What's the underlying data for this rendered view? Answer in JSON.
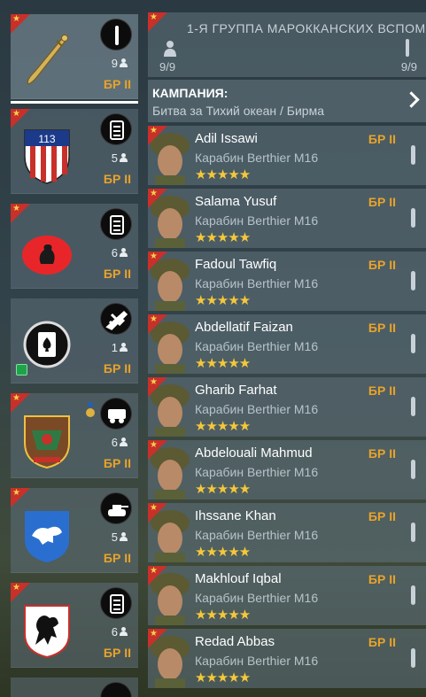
{
  "squads": [
    {
      "count": "9",
      "br": "БР II",
      "type_icon": "rifle-icon",
      "emblem": "dagger-emblem",
      "selected": true
    },
    {
      "count": "5",
      "br": "БР II",
      "type_icon": "clipboard-icon",
      "emblem": "shield-113-emblem"
    },
    {
      "count": "6",
      "br": "БР II",
      "type_icon": "clipboard-icon",
      "emblem": "red-creature-emblem"
    },
    {
      "count": "1",
      "br": "БР II",
      "type_icon": "plane-icon",
      "emblem": "ace-spades-emblem",
      "premium": true
    },
    {
      "count": "6",
      "br": "БР II",
      "type_icon": "vehicle-icon",
      "emblem": "regiment-shield-emblem",
      "medal": true
    },
    {
      "count": "5",
      "br": "БР II",
      "type_icon": "tank-icon",
      "emblem": "lion-shield-emblem"
    },
    {
      "count": "6",
      "br": "БР II",
      "type_icon": "clipboard-icon",
      "emblem": "black-lion-emblem"
    }
  ],
  "header": {
    "title": "1-Я ГРУППА МАРОККАНСКИХ ВСПОМ",
    "left_count": "9/9",
    "right_count": "9/9"
  },
  "campaign": {
    "label": "КАМПАНИЯ:",
    "value": "Битва за Тихий океан / Бирма"
  },
  "soldiers": [
    {
      "name": "Adil Issawi",
      "weapon": "Карабин Berthier M16",
      "br": "БР II",
      "stars": "★★★★★"
    },
    {
      "name": "Salama Yusuf",
      "weapon": "Карабин Berthier M16",
      "br": "БР II",
      "stars": "★★★★★"
    },
    {
      "name": "Fadoul Tawfiq",
      "weapon": "Карабин Berthier M16",
      "br": "БР II",
      "stars": "★★★★★"
    },
    {
      "name": "Abdellatif Faizan",
      "weapon": "Карабин Berthier M16",
      "br": "БР II",
      "stars": "★★★★★"
    },
    {
      "name": "Gharib Farhat",
      "weapon": "Карабин Berthier M16",
      "br": "БР II",
      "stars": "★★★★★"
    },
    {
      "name": "Abdelouali Mahmud",
      "weapon": "Карабин Berthier M16",
      "br": "БР II",
      "stars": "★★★★★"
    },
    {
      "name": "Ihssane Khan",
      "weapon": "Карабин Berthier M16",
      "br": "БР II",
      "stars": "★★★★★"
    },
    {
      "name": "Makhlouf Iqbal",
      "weapon": "Карабин Berthier M16",
      "br": "БР II",
      "stars": "★★★★★"
    },
    {
      "name": "Redad Abbas",
      "weapon": "Карабин Berthier M16",
      "br": "БР II",
      "stars": "★★★★★"
    }
  ],
  "colors": {
    "accent": "#e8a32a",
    "flag": "#c8302a",
    "star": "#f5c83a"
  }
}
